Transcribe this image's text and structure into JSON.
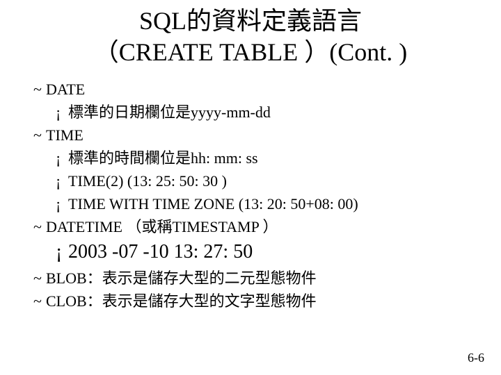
{
  "title_line1": "SQL的資料定義語言",
  "title_line2": "（CREATE TABLE ）(Cont. )",
  "items": {
    "date": {
      "label": "DATE",
      "sub1": "標準的日期欄位是yyyy-mm-dd"
    },
    "time": {
      "label": "TIME",
      "sub1": "標準的時間欄位是hh: mm: ss",
      "sub2": "TIME(2) (13: 25: 50: 30 )",
      "sub3": "TIME WITH TIME ZONE  (13: 20: 50+08: 00)"
    },
    "datetime": {
      "label": "DATETIME （或稱TIMESTAMP ）",
      "sub1": "2003 -07 -10 13: 27: 50"
    },
    "blob": {
      "label": "BLOB：表示是儲存大型的二元型態物件"
    },
    "clob": {
      "label": "CLOB：表示是儲存大型的文字型態物件"
    }
  },
  "bullets": {
    "l1": "~",
    "l2": "¡"
  },
  "footer": "6-6"
}
